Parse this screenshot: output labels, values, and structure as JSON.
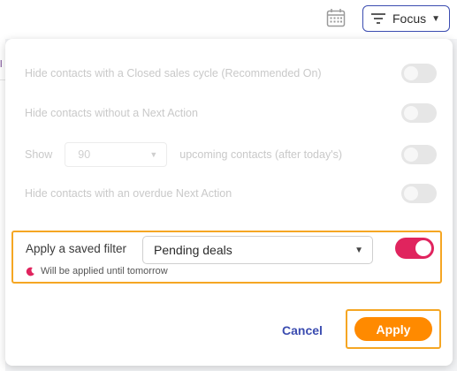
{
  "header": {
    "calendar_icon": "calendar-icon",
    "focus_label": "Focus",
    "filter_icon": "filter-lines-icon"
  },
  "panel": {
    "rows": [
      {
        "label": "Hide contacts with a Closed sales cycle (Recommended On)",
        "enabled": false
      },
      {
        "label": "Hide contacts without a Next Action",
        "enabled": false
      },
      {
        "prefix": "Show",
        "select_value": "90",
        "suffix": "upcoming contacts (after today's)",
        "enabled": false
      },
      {
        "label": "Hide contacts with an overdue Next Action",
        "enabled": false
      }
    ],
    "saved_filter": {
      "label": "Apply a saved filter",
      "value": "Pending deals",
      "enabled": true,
      "note": "Will be applied until tomorrow"
    },
    "actions": {
      "cancel_label": "Cancel",
      "apply_label": "Apply"
    }
  },
  "colors": {
    "accent_blue": "#3b4cb0",
    "highlight_orange": "#f5a623",
    "apply_orange": "#ff8a00",
    "toggle_on_pink": "#e0245e"
  }
}
